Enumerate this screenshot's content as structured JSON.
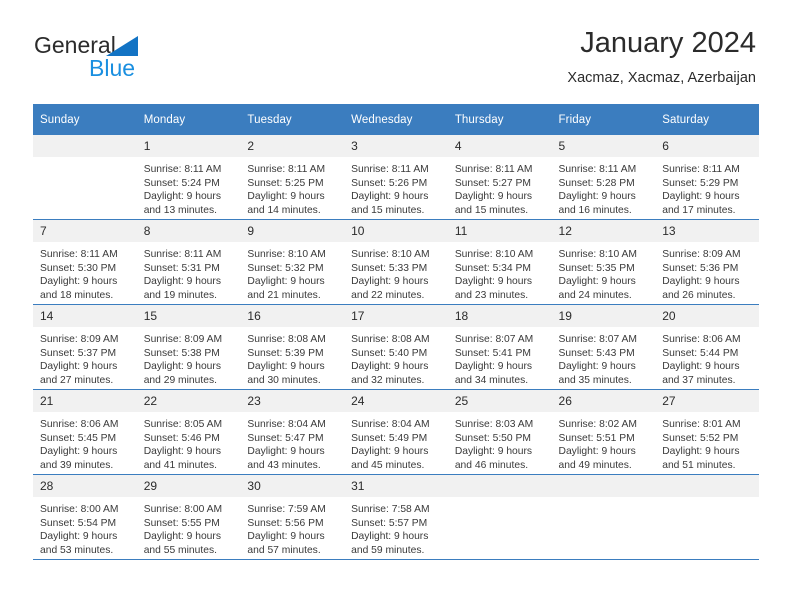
{
  "brand": {
    "name_part1": "General",
    "name_part2": "Blue",
    "triangle_color": "#1273c4",
    "blue_text_color": "#1a8fe0"
  },
  "header": {
    "title": "January 2024",
    "subtitle": "Xacmaz, Xacmaz, Azerbaijan"
  },
  "colors": {
    "header_blue": "#3b7dbf",
    "daynum_bg": "#f1f1f1",
    "text": "#333333"
  },
  "weekday_headers": [
    "Sunday",
    "Monday",
    "Tuesday",
    "Wednesday",
    "Thursday",
    "Friday",
    "Saturday"
  ],
  "weeks": [
    [
      {
        "day": "",
        "sunrise": "",
        "sunset": "",
        "daylight1": "",
        "daylight2": ""
      },
      {
        "day": "1",
        "sunrise": "Sunrise: 8:11 AM",
        "sunset": "Sunset: 5:24 PM",
        "daylight1": "Daylight: 9 hours",
        "daylight2": "and 13 minutes."
      },
      {
        "day": "2",
        "sunrise": "Sunrise: 8:11 AM",
        "sunset": "Sunset: 5:25 PM",
        "daylight1": "Daylight: 9 hours",
        "daylight2": "and 14 minutes."
      },
      {
        "day": "3",
        "sunrise": "Sunrise: 8:11 AM",
        "sunset": "Sunset: 5:26 PM",
        "daylight1": "Daylight: 9 hours",
        "daylight2": "and 15 minutes."
      },
      {
        "day": "4",
        "sunrise": "Sunrise: 8:11 AM",
        "sunset": "Sunset: 5:27 PM",
        "daylight1": "Daylight: 9 hours",
        "daylight2": "and 15 minutes."
      },
      {
        "day": "5",
        "sunrise": "Sunrise: 8:11 AM",
        "sunset": "Sunset: 5:28 PM",
        "daylight1": "Daylight: 9 hours",
        "daylight2": "and 16 minutes."
      },
      {
        "day": "6",
        "sunrise": "Sunrise: 8:11 AM",
        "sunset": "Sunset: 5:29 PM",
        "daylight1": "Daylight: 9 hours",
        "daylight2": "and 17 minutes."
      }
    ],
    [
      {
        "day": "7",
        "sunrise": "Sunrise: 8:11 AM",
        "sunset": "Sunset: 5:30 PM",
        "daylight1": "Daylight: 9 hours",
        "daylight2": "and 18 minutes."
      },
      {
        "day": "8",
        "sunrise": "Sunrise: 8:11 AM",
        "sunset": "Sunset: 5:31 PM",
        "daylight1": "Daylight: 9 hours",
        "daylight2": "and 19 minutes."
      },
      {
        "day": "9",
        "sunrise": "Sunrise: 8:10 AM",
        "sunset": "Sunset: 5:32 PM",
        "daylight1": "Daylight: 9 hours",
        "daylight2": "and 21 minutes."
      },
      {
        "day": "10",
        "sunrise": "Sunrise: 8:10 AM",
        "sunset": "Sunset: 5:33 PM",
        "daylight1": "Daylight: 9 hours",
        "daylight2": "and 22 minutes."
      },
      {
        "day": "11",
        "sunrise": "Sunrise: 8:10 AM",
        "sunset": "Sunset: 5:34 PM",
        "daylight1": "Daylight: 9 hours",
        "daylight2": "and 23 minutes."
      },
      {
        "day": "12",
        "sunrise": "Sunrise: 8:10 AM",
        "sunset": "Sunset: 5:35 PM",
        "daylight1": "Daylight: 9 hours",
        "daylight2": "and 24 minutes."
      },
      {
        "day": "13",
        "sunrise": "Sunrise: 8:09 AM",
        "sunset": "Sunset: 5:36 PM",
        "daylight1": "Daylight: 9 hours",
        "daylight2": "and 26 minutes."
      }
    ],
    [
      {
        "day": "14",
        "sunrise": "Sunrise: 8:09 AM",
        "sunset": "Sunset: 5:37 PM",
        "daylight1": "Daylight: 9 hours",
        "daylight2": "and 27 minutes."
      },
      {
        "day": "15",
        "sunrise": "Sunrise: 8:09 AM",
        "sunset": "Sunset: 5:38 PM",
        "daylight1": "Daylight: 9 hours",
        "daylight2": "and 29 minutes."
      },
      {
        "day": "16",
        "sunrise": "Sunrise: 8:08 AM",
        "sunset": "Sunset: 5:39 PM",
        "daylight1": "Daylight: 9 hours",
        "daylight2": "and 30 minutes."
      },
      {
        "day": "17",
        "sunrise": "Sunrise: 8:08 AM",
        "sunset": "Sunset: 5:40 PM",
        "daylight1": "Daylight: 9 hours",
        "daylight2": "and 32 minutes."
      },
      {
        "day": "18",
        "sunrise": "Sunrise: 8:07 AM",
        "sunset": "Sunset: 5:41 PM",
        "daylight1": "Daylight: 9 hours",
        "daylight2": "and 34 minutes."
      },
      {
        "day": "19",
        "sunrise": "Sunrise: 8:07 AM",
        "sunset": "Sunset: 5:43 PM",
        "daylight1": "Daylight: 9 hours",
        "daylight2": "and 35 minutes."
      },
      {
        "day": "20",
        "sunrise": "Sunrise: 8:06 AM",
        "sunset": "Sunset: 5:44 PM",
        "daylight1": "Daylight: 9 hours",
        "daylight2": "and 37 minutes."
      }
    ],
    [
      {
        "day": "21",
        "sunrise": "Sunrise: 8:06 AM",
        "sunset": "Sunset: 5:45 PM",
        "daylight1": "Daylight: 9 hours",
        "daylight2": "and 39 minutes."
      },
      {
        "day": "22",
        "sunrise": "Sunrise: 8:05 AM",
        "sunset": "Sunset: 5:46 PM",
        "daylight1": "Daylight: 9 hours",
        "daylight2": "and 41 minutes."
      },
      {
        "day": "23",
        "sunrise": "Sunrise: 8:04 AM",
        "sunset": "Sunset: 5:47 PM",
        "daylight1": "Daylight: 9 hours",
        "daylight2": "and 43 minutes."
      },
      {
        "day": "24",
        "sunrise": "Sunrise: 8:04 AM",
        "sunset": "Sunset: 5:49 PM",
        "daylight1": "Daylight: 9 hours",
        "daylight2": "and 45 minutes."
      },
      {
        "day": "25",
        "sunrise": "Sunrise: 8:03 AM",
        "sunset": "Sunset: 5:50 PM",
        "daylight1": "Daylight: 9 hours",
        "daylight2": "and 46 minutes."
      },
      {
        "day": "26",
        "sunrise": "Sunrise: 8:02 AM",
        "sunset": "Sunset: 5:51 PM",
        "daylight1": "Daylight: 9 hours",
        "daylight2": "and 49 minutes."
      },
      {
        "day": "27",
        "sunrise": "Sunrise: 8:01 AM",
        "sunset": "Sunset: 5:52 PM",
        "daylight1": "Daylight: 9 hours",
        "daylight2": "and 51 minutes."
      }
    ],
    [
      {
        "day": "28",
        "sunrise": "Sunrise: 8:00 AM",
        "sunset": "Sunset: 5:54 PM",
        "daylight1": "Daylight: 9 hours",
        "daylight2": "and 53 minutes."
      },
      {
        "day": "29",
        "sunrise": "Sunrise: 8:00 AM",
        "sunset": "Sunset: 5:55 PM",
        "daylight1": "Daylight: 9 hours",
        "daylight2": "and 55 minutes."
      },
      {
        "day": "30",
        "sunrise": "Sunrise: 7:59 AM",
        "sunset": "Sunset: 5:56 PM",
        "daylight1": "Daylight: 9 hours",
        "daylight2": "and 57 minutes."
      },
      {
        "day": "31",
        "sunrise": "Sunrise: 7:58 AM",
        "sunset": "Sunset: 5:57 PM",
        "daylight1": "Daylight: 9 hours",
        "daylight2": "and 59 minutes."
      },
      {
        "day": "",
        "sunrise": "",
        "sunset": "",
        "daylight1": "",
        "daylight2": ""
      },
      {
        "day": "",
        "sunrise": "",
        "sunset": "",
        "daylight1": "",
        "daylight2": ""
      },
      {
        "day": "",
        "sunrise": "",
        "sunset": "",
        "daylight1": "",
        "daylight2": ""
      }
    ]
  ]
}
